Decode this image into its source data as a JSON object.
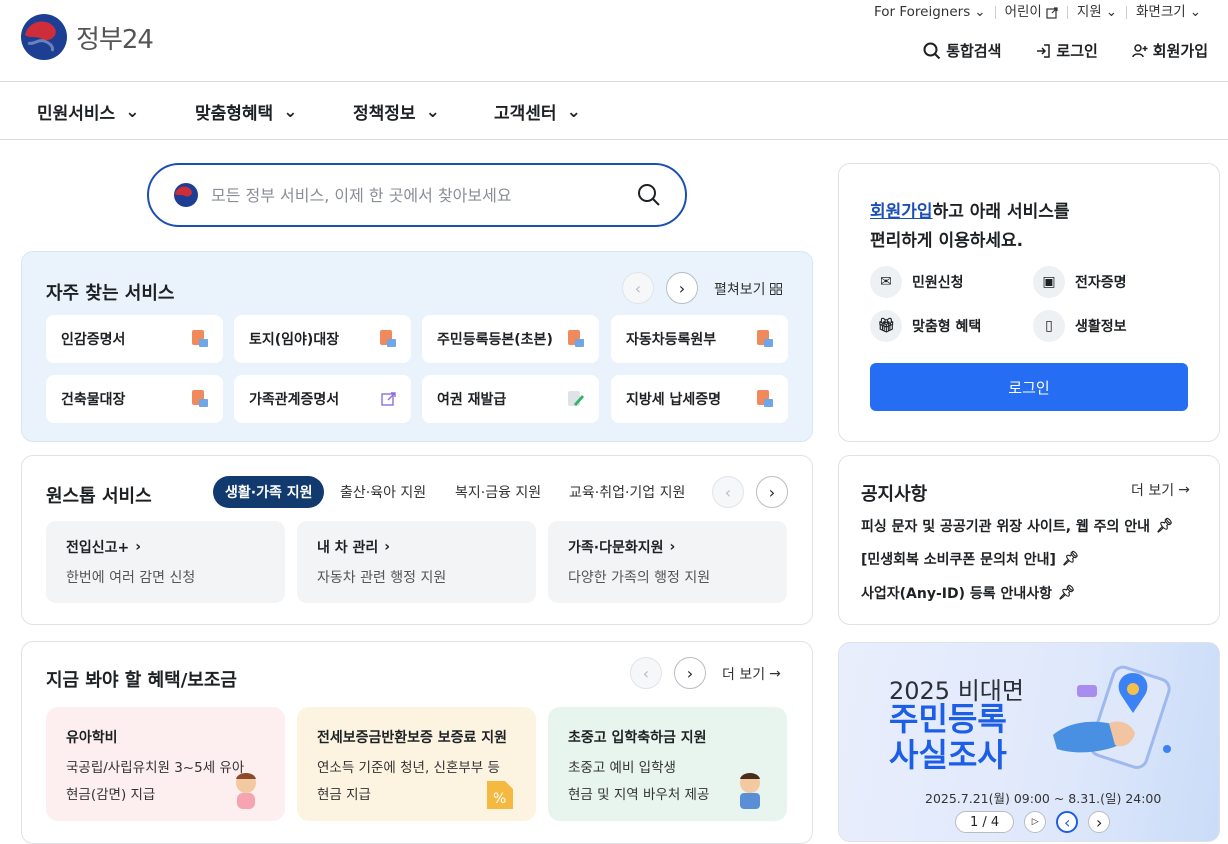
{
  "header": {
    "logo_text": "정부24",
    "utility": [
      "For Foreigners",
      "어린이",
      "지원",
      "화면크기"
    ],
    "main_links": [
      "통합검색",
      "로그인",
      "회원가입"
    ]
  },
  "gnb": [
    "민원서비스",
    "맞춤형혜택",
    "정책정보",
    "고객센터"
  ],
  "search": {
    "placeholder": "모든 정부 서비스, 이제 한 곳에서 찾아보세요"
  },
  "frequent": {
    "title": "자주 찾는 서비스",
    "expand_label": "펼쳐보기",
    "items": [
      "인감증명서",
      "토지(임야)대장",
      "주민등록등본(초본)",
      "자동차등록원부",
      "건축물대장",
      "가족관계증명서",
      "여권 재발급",
      "지방세 납세증명"
    ]
  },
  "onestop": {
    "title": "원스톱 서비스",
    "tabs": [
      "생활·가족 지원",
      "출산·육아 지원",
      "복지·금융 지원",
      "교육·취업·기업 지원"
    ],
    "cards": [
      {
        "title": "전입신고+",
        "desc": "한번에 여러 감면 신청"
      },
      {
        "title": "내 차 관리",
        "desc": "자동차 관련 행정 지원"
      },
      {
        "title": "가족·다문화지원",
        "desc": "다양한 가족의 행정 지원"
      }
    ]
  },
  "benefits": {
    "title": "지금 봐야 할 혜택/보조금",
    "more": "더 보기",
    "cards": [
      {
        "title": "유아학비",
        "line1": "국공립/사립유치원 3~5세 유아",
        "line2": "현금(감면) 지급",
        "bg": "#fdeef0"
      },
      {
        "title": "전세보증금반환보증 보증료 지원",
        "line1": "연소득 기준에 청년, 신혼부부 등",
        "line2": "현금 지급",
        "bg": "#fdf3e1"
      },
      {
        "title": "초중고 입학축하금 지원",
        "line1": "초중고 예비 입학생",
        "line2": "현금 및 지역 바우처 제공",
        "bg": "#e8f5ee"
      }
    ]
  },
  "member": {
    "headline_link": "회원가입",
    "headline_rest": "하고 아래 서비스를",
    "headline_line2": "편리하게 이용하세요.",
    "features": [
      "민원신청",
      "전자증명",
      "맞춤형 혜택",
      "생활정보"
    ],
    "login_button": "로그인"
  },
  "notices": {
    "title": "공지사항",
    "more": "더 보기",
    "items": [
      "피싱 문자 및 공공기관 위장 사이트, 웹 주의 안내",
      "[민생회복 소비쿠폰 문의처 안내]",
      "사업자(Any-ID) 등록 안내사항"
    ]
  },
  "banner": {
    "line1": "2025 비대면",
    "line2": "주민등록",
    "line3": "사실조사",
    "period": "2025.7.21(월) 09:00 ~ 8.31.(일) 24:00",
    "pager": "1 / 4"
  },
  "colors": {
    "primary": "#256ef4",
    "navy": "#113a6e",
    "link": "#1c4fb6"
  }
}
